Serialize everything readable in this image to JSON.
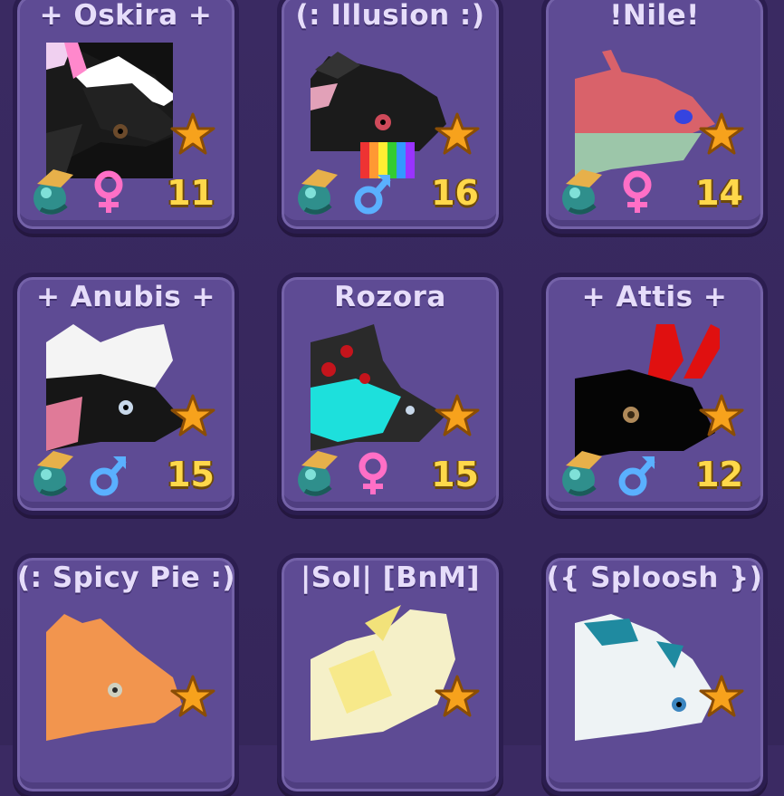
{
  "cards": [
    {
      "name": "+ Oskira +",
      "level": "11",
      "gender": "female",
      "portrait": "black-white-dragon-icon"
    },
    {
      "name": "(: Illusion :)",
      "level": "16",
      "gender": "male",
      "portrait": "black-rainbow-dragon-icon"
    },
    {
      "name": "!Nile!",
      "level": "14",
      "gender": "female",
      "portrait": "red-mint-dragon-icon"
    },
    {
      "name": "+ Anubis +",
      "level": "15",
      "gender": "male",
      "portrait": "black-pink-white-dragon-icon"
    },
    {
      "name": "Rozora",
      "level": "15",
      "gender": "female",
      "portrait": "black-cyan-rose-dragon-icon"
    },
    {
      "name": "+ Attis +",
      "level": "12",
      "gender": "male",
      "portrait": "black-red-horn-dragon-icon"
    },
    {
      "name": "(: Spicy Pie :)",
      "level": "",
      "gender": "",
      "portrait": "orange-dragon-icon"
    },
    {
      "name": "|Sol| [BnM]",
      "level": "",
      "gender": "",
      "portrait": "cream-yellow-dragon-icon"
    },
    {
      "name": "({ Sploosh })",
      "level": "",
      "gender": "",
      "portrait": "white-teal-dragon-icon"
    }
  ],
  "colors": {
    "background": "#3b2a63",
    "card": "#5e4b94",
    "name_text": "#e6ddfa",
    "level_text": "#ffd84a",
    "star": "#f7a21c",
    "female": "#ff6fc6",
    "male": "#5ab0ff"
  }
}
